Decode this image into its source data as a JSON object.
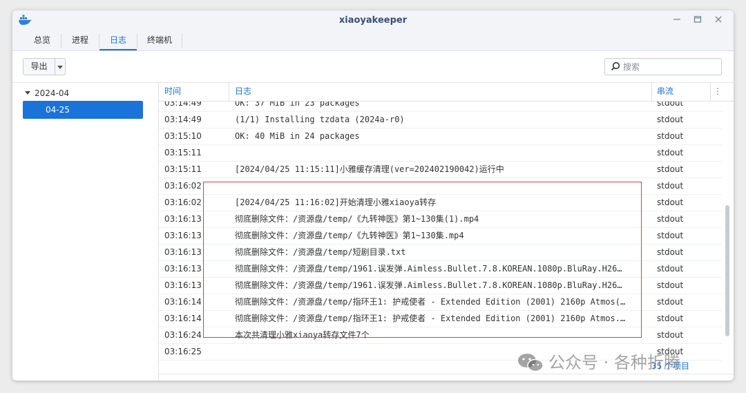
{
  "window": {
    "title": "xiaoyakeeper",
    "controls": [
      "minimize-icon",
      "maximize-icon",
      "close-icon"
    ]
  },
  "tabs": [
    {
      "label": "总览",
      "active": false
    },
    {
      "label": "进程",
      "active": false
    },
    {
      "label": "日志",
      "active": true
    },
    {
      "label": "终端机",
      "active": false
    }
  ],
  "toolbar": {
    "export_label": "导出",
    "search_placeholder": "搜索"
  },
  "sidebar": {
    "year": "2024-04",
    "days": [
      {
        "label": "04-25",
        "selected": true
      }
    ]
  },
  "table": {
    "columns": {
      "time": "时间",
      "log": "日志",
      "stream": "串流"
    },
    "rows": [
      {
        "time": "03:14:49",
        "log": "OK: 37 MiB in 23 packages",
        "stream": "stdout"
      },
      {
        "time": "03:14:49",
        "log": "(1/1) Installing tzdata (2024a-r0)",
        "stream": "stdout"
      },
      {
        "time": "03:15:10",
        "log": "OK: 40 MiB in 24 packages",
        "stream": "stdout"
      },
      {
        "time": "03:15:11",
        "log": "",
        "stream": "stdout"
      },
      {
        "time": "03:15:11",
        "log": "[2024/04/25 11:15:11]小雅缓存清理(ver=202402190042)运行中",
        "stream": "stdout"
      },
      {
        "time": "03:16:02",
        "log": "",
        "stream": "stdout"
      },
      {
        "time": "03:16:02",
        "log": "[2024/04/25 11:16:02]开始清理小雅xiaoya转存",
        "stream": "stdout"
      },
      {
        "time": "03:16:13",
        "log": "彻底删除文件：/资源盘/temp/《九转神医》第1~130集(1).mp4",
        "stream": "stdout"
      },
      {
        "time": "03:16:13",
        "log": "彻底删除文件：/资源盘/temp/《九转神医》第1~130集.mp4",
        "stream": "stdout"
      },
      {
        "time": "03:16:13",
        "log": "彻底删除文件：/资源盘/temp/短剧目录.txt",
        "stream": "stdout"
      },
      {
        "time": "03:16:13",
        "log": "彻底删除文件：/资源盘/temp/1961.误发弹.Aimless.Bullet.7.8.KOREAN.1080p.BluRay.H26…",
        "stream": "stdout"
      },
      {
        "time": "03:16:13",
        "log": "彻底删除文件：/资源盘/temp/1961.误发弹.Aimless.Bullet.7.8.KOREAN.1080p.BluRay.H26…",
        "stream": "stdout"
      },
      {
        "time": "03:16:14",
        "log": "彻底删除文件：/资源盘/temp/指环王1: 护戒使者 - Extended Edition (2001) 2160p Atmos(…",
        "stream": "stdout"
      },
      {
        "time": "03:16:14",
        "log": "彻底删除文件：/资源盘/temp/指环王1: 护戒使者 - Extended Edition (2001) 2160p Atmos.…",
        "stream": "stdout"
      },
      {
        "time": "03:16:24",
        "log": "本次共清理小雅xiaoya转存文件7个",
        "stream": "stdout"
      },
      {
        "time": "03:16:25",
        "log": "",
        "stream": "stdout"
      }
    ]
  },
  "footer": {
    "count_label": "35 个项目"
  },
  "watermark": {
    "text": "公众号 · 各种折腾"
  },
  "colors": {
    "accent": "#1a73d9",
    "highlight": "#e53935"
  }
}
